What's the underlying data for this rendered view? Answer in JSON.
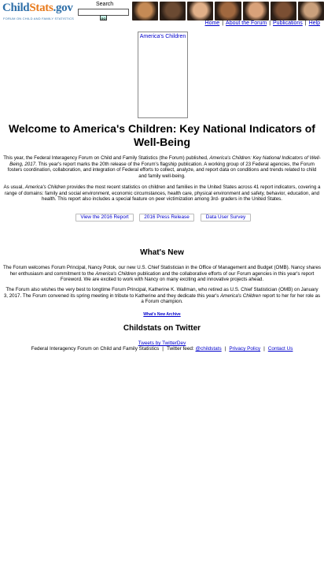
{
  "header": {
    "logo": {
      "child": "Child",
      "stats": "Stats",
      "gov": ".gov",
      "tagline": "FORUM ON CHILD AND FAMILY STATISTICS"
    },
    "search": {
      "label": "Search",
      "value": "",
      "go": "GO"
    },
    "nav": [
      "Home",
      "About the Forum",
      "Publications",
      "Help"
    ],
    "photo_colors": [
      "#c58a55",
      "#6b4a32",
      "#e1b089",
      "#a0683f",
      "#d9a27a",
      "#7b4f33",
      "#caa07c"
    ]
  },
  "feature_box": {
    "label": "America's Children"
  },
  "welcome": {
    "title": "Welcome to America's Children: Key National Indicators of Well-Being",
    "p1_a": "This year, the Federal Interagency Forum on Child and Family Statistics (the Forum) published, ",
    "p1_em": "America's Children: Key National Indicators of Well-Being, 2017",
    "p1_b": ". This year's report marks the 20th release of the Forum's flagship publication. A working group of 23 Federal agencies, the Forum fosters coordination, collaboration, and integration of Federal efforts to collect, analyze, and report data on conditions and trends related to child and family well-being.",
    "p2_a": "As usual, ",
    "p2_em": "America's Children",
    "p2_b": " provides the most recent statistics on children and families in the United States across 41 report indicators, covering a range of domains: family and social environment, economic circumstances, health care, physical environment and safety, behavior, education, and health. This report also includes a special feature on peer victimization among 3rd- graders in the United States."
  },
  "buttons": [
    "View the 2016 Report",
    "2016 Press Release",
    "Data User Survey"
  ],
  "whats_new": {
    "heading": "What's New",
    "p1_a": "The Forum welcomes Forum Principal, Nancy Potok, our new U.S. Chief Statistician in the Office of Management and Budget (OMB). Nancy shares her enthusiasm and commitment to the ",
    "p1_em": "America's Children",
    "p1_b": " publication and the collaborative efforts of our Forum agencies in this year's report Foreword. We are excited to work with Nancy on many exciting and innovative projects ahead.",
    "p2_a": "The Forum also wishes the very best to longtime Forum Principal, Katherine K. Wallman, who retired as U.S. Chief Statistician (OMB) on January 3, 2017. The Forum convened its spring meeting in tribute to Katherine and they dedicate this year's ",
    "p2_em": "America's Children",
    "p2_b": " report to her for her role as a Forum champion.",
    "archive": "What's New Archive"
  },
  "twitter": {
    "heading": "Childstats on Twitter",
    "tweets_by": "Tweets by TwitterDev"
  },
  "footer": {
    "org": "Federal Interagency Forum on Child and Family Statistics",
    "feed_label": "Twitter feed: ",
    "feed_handle": "@childstats",
    "privacy": "Privacy Policy",
    "contact": "Contact Us"
  }
}
